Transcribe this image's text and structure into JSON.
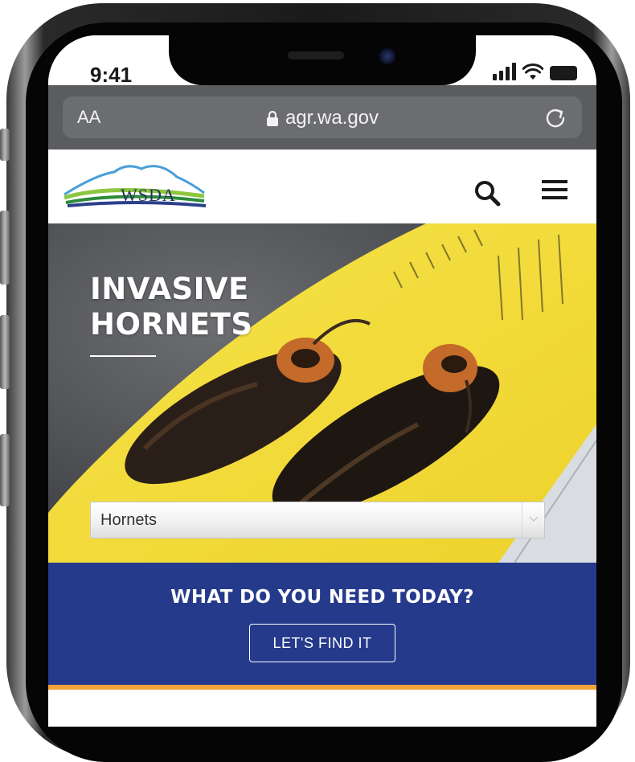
{
  "status_bar": {
    "time": "9:41"
  },
  "browser": {
    "text_size_label": "AA",
    "url": "agr.wa.gov"
  },
  "header": {
    "logo_text": "WSDA"
  },
  "hero": {
    "title_line1": "INVASIVE",
    "title_line2": "HORNETS",
    "topic_select": {
      "selected": "Hornets"
    }
  },
  "cta": {
    "heading": "WHAT DO YOU NEED TODAY?",
    "button_label": "LET'S FIND IT"
  },
  "colors": {
    "band_blue": "#263a8c",
    "accent_orange": "#f2a33a",
    "browser_gray": "#5b5c60",
    "ruler_yellow": "#f2dd3a"
  }
}
